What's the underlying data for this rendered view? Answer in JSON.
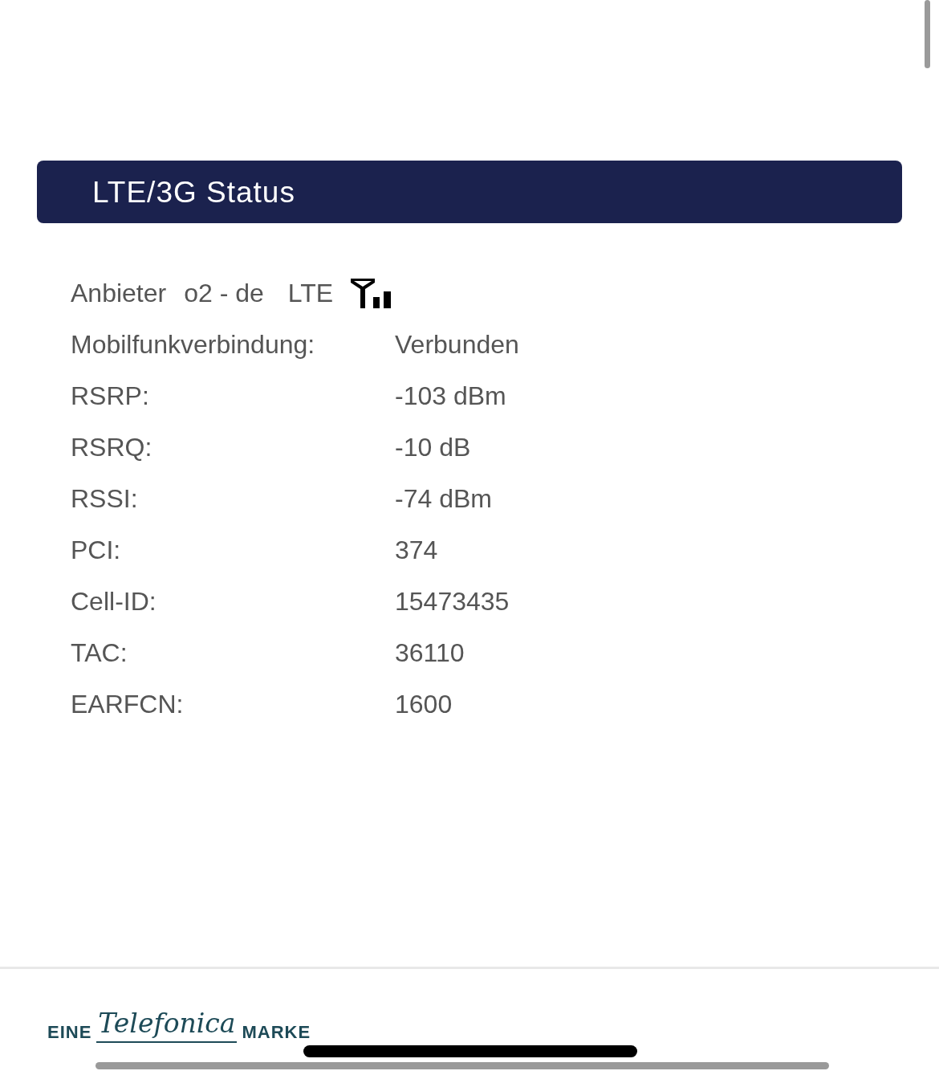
{
  "header": {
    "title": "LTE/3G Status"
  },
  "provider": {
    "label": "Anbieter",
    "operator": "o2 - de",
    "technology": "LTE"
  },
  "rows": [
    {
      "label": "Mobilfunkverbindung:",
      "value": "Verbunden"
    },
    {
      "label": "RSRP:",
      "value": "-103 dBm"
    },
    {
      "label": "RSRQ:",
      "value": "-10 dB"
    },
    {
      "label": "RSSI:",
      "value": "-74 dBm"
    },
    {
      "label": "PCI:",
      "value": "374"
    },
    {
      "label": "Cell-ID:",
      "value": "15473435"
    },
    {
      "label": "TAC:",
      "value": "36110"
    },
    {
      "label": "EARFCN:",
      "value": "1600"
    }
  ],
  "footer": {
    "logo": {
      "prefix": "EINE",
      "brand": "Telefonica",
      "suffix": "MARKE"
    }
  }
}
